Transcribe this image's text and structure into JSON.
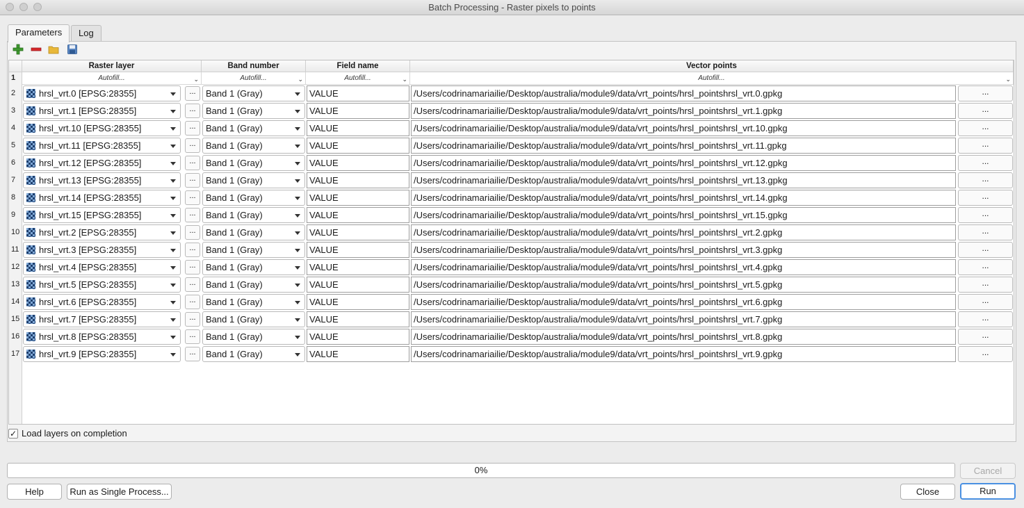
{
  "window": {
    "title": "Batch Processing - Raster pixels to points"
  },
  "tabs": [
    {
      "label": "Parameters"
    },
    {
      "label": "Log"
    }
  ],
  "toolbar": {
    "icons": [
      "add-row-icon",
      "remove-row-icon",
      "open-icon",
      "save-icon"
    ]
  },
  "table": {
    "headers": {
      "raster_layer": "Raster layer",
      "band_number": "Band number",
      "field_name": "Field name",
      "vector_points": "Vector points"
    },
    "autofill_label": "Autofill...",
    "autofill_row": "1",
    "browse_label": "...",
    "rows": [
      {
        "num": "2",
        "layer": "hrsl_vrt.0 [EPSG:28355]",
        "band": "Band 1 (Gray)",
        "field": "VALUE",
        "output": "/Users/codrinamariailie/Desktop/australia/module9/data/vrt_points/hrsl_pointshrsl_vrt.0.gpkg"
      },
      {
        "num": "3",
        "layer": "hrsl_vrt.1 [EPSG:28355]",
        "band": "Band 1 (Gray)",
        "field": "VALUE",
        "output": "/Users/codrinamariailie/Desktop/australia/module9/data/vrt_points/hrsl_pointshrsl_vrt.1.gpkg"
      },
      {
        "num": "4",
        "layer": "hrsl_vrt.10 [EPSG:28355]",
        "band": "Band 1 (Gray)",
        "field": "VALUE",
        "output": "/Users/codrinamariailie/Desktop/australia/module9/data/vrt_points/hrsl_pointshrsl_vrt.10.gpkg"
      },
      {
        "num": "5",
        "layer": "hrsl_vrt.11 [EPSG:28355]",
        "band": "Band 1 (Gray)",
        "field": "VALUE",
        "output": "/Users/codrinamariailie/Desktop/australia/module9/data/vrt_points/hrsl_pointshrsl_vrt.11.gpkg"
      },
      {
        "num": "6",
        "layer": "hrsl_vrt.12 [EPSG:28355]",
        "band": "Band 1 (Gray)",
        "field": "VALUE",
        "output": "/Users/codrinamariailie/Desktop/australia/module9/data/vrt_points/hrsl_pointshrsl_vrt.12.gpkg"
      },
      {
        "num": "7",
        "layer": "hrsl_vrt.13 [EPSG:28355]",
        "band": "Band 1 (Gray)",
        "field": "VALUE",
        "output": "/Users/codrinamariailie/Desktop/australia/module9/data/vrt_points/hrsl_pointshrsl_vrt.13.gpkg"
      },
      {
        "num": "8",
        "layer": "hrsl_vrt.14 [EPSG:28355]",
        "band": "Band 1 (Gray)",
        "field": "VALUE",
        "output": "/Users/codrinamariailie/Desktop/australia/module9/data/vrt_points/hrsl_pointshrsl_vrt.14.gpkg"
      },
      {
        "num": "9",
        "layer": "hrsl_vrt.15 [EPSG:28355]",
        "band": "Band 1 (Gray)",
        "field": "VALUE",
        "output": "/Users/codrinamariailie/Desktop/australia/module9/data/vrt_points/hrsl_pointshrsl_vrt.15.gpkg"
      },
      {
        "num": "10",
        "layer": "hrsl_vrt.2 [EPSG:28355]",
        "band": "Band 1 (Gray)",
        "field": "VALUE",
        "output": "/Users/codrinamariailie/Desktop/australia/module9/data/vrt_points/hrsl_pointshrsl_vrt.2.gpkg"
      },
      {
        "num": "11",
        "layer": "hrsl_vrt.3 [EPSG:28355]",
        "band": "Band 1 (Gray)",
        "field": "VALUE",
        "output": "/Users/codrinamariailie/Desktop/australia/module9/data/vrt_points/hrsl_pointshrsl_vrt.3.gpkg"
      },
      {
        "num": "12",
        "layer": "hrsl_vrt.4 [EPSG:28355]",
        "band": "Band 1 (Gray)",
        "field": "VALUE",
        "output": "/Users/codrinamariailie/Desktop/australia/module9/data/vrt_points/hrsl_pointshrsl_vrt.4.gpkg"
      },
      {
        "num": "13",
        "layer": "hrsl_vrt.5 [EPSG:28355]",
        "band": "Band 1 (Gray)",
        "field": "VALUE",
        "output": "/Users/codrinamariailie/Desktop/australia/module9/data/vrt_points/hrsl_pointshrsl_vrt.5.gpkg"
      },
      {
        "num": "14",
        "layer": "hrsl_vrt.6 [EPSG:28355]",
        "band": "Band 1 (Gray)",
        "field": "VALUE",
        "output": "/Users/codrinamariailie/Desktop/australia/module9/data/vrt_points/hrsl_pointshrsl_vrt.6.gpkg"
      },
      {
        "num": "15",
        "layer": "hrsl_vrt.7 [EPSG:28355]",
        "band": "Band 1 (Gray)",
        "field": "VALUE",
        "output": "/Users/codrinamariailie/Desktop/australia/module9/data/vrt_points/hrsl_pointshrsl_vrt.7.gpkg"
      },
      {
        "num": "16",
        "layer": "hrsl_vrt.8 [EPSG:28355]",
        "band": "Band 1 (Gray)",
        "field": "VALUE",
        "output": "/Users/codrinamariailie/Desktop/australia/module9/data/vrt_points/hrsl_pointshrsl_vrt.8.gpkg"
      },
      {
        "num": "17",
        "layer": "hrsl_vrt.9 [EPSG:28355]",
        "band": "Band 1 (Gray)",
        "field": "VALUE",
        "output": "/Users/codrinamariailie/Desktop/australia/module9/data/vrt_points/hrsl_pointshrsl_vrt.9.gpkg"
      }
    ]
  },
  "load_layers": {
    "label": "Load layers on completion",
    "checked": true,
    "mark": "✓"
  },
  "progress": {
    "text": "0%",
    "value": 0
  },
  "buttons": {
    "help": "Help",
    "run_single": "Run as Single Process...",
    "cancel": "Cancel",
    "close": "Close",
    "run": "Run"
  }
}
